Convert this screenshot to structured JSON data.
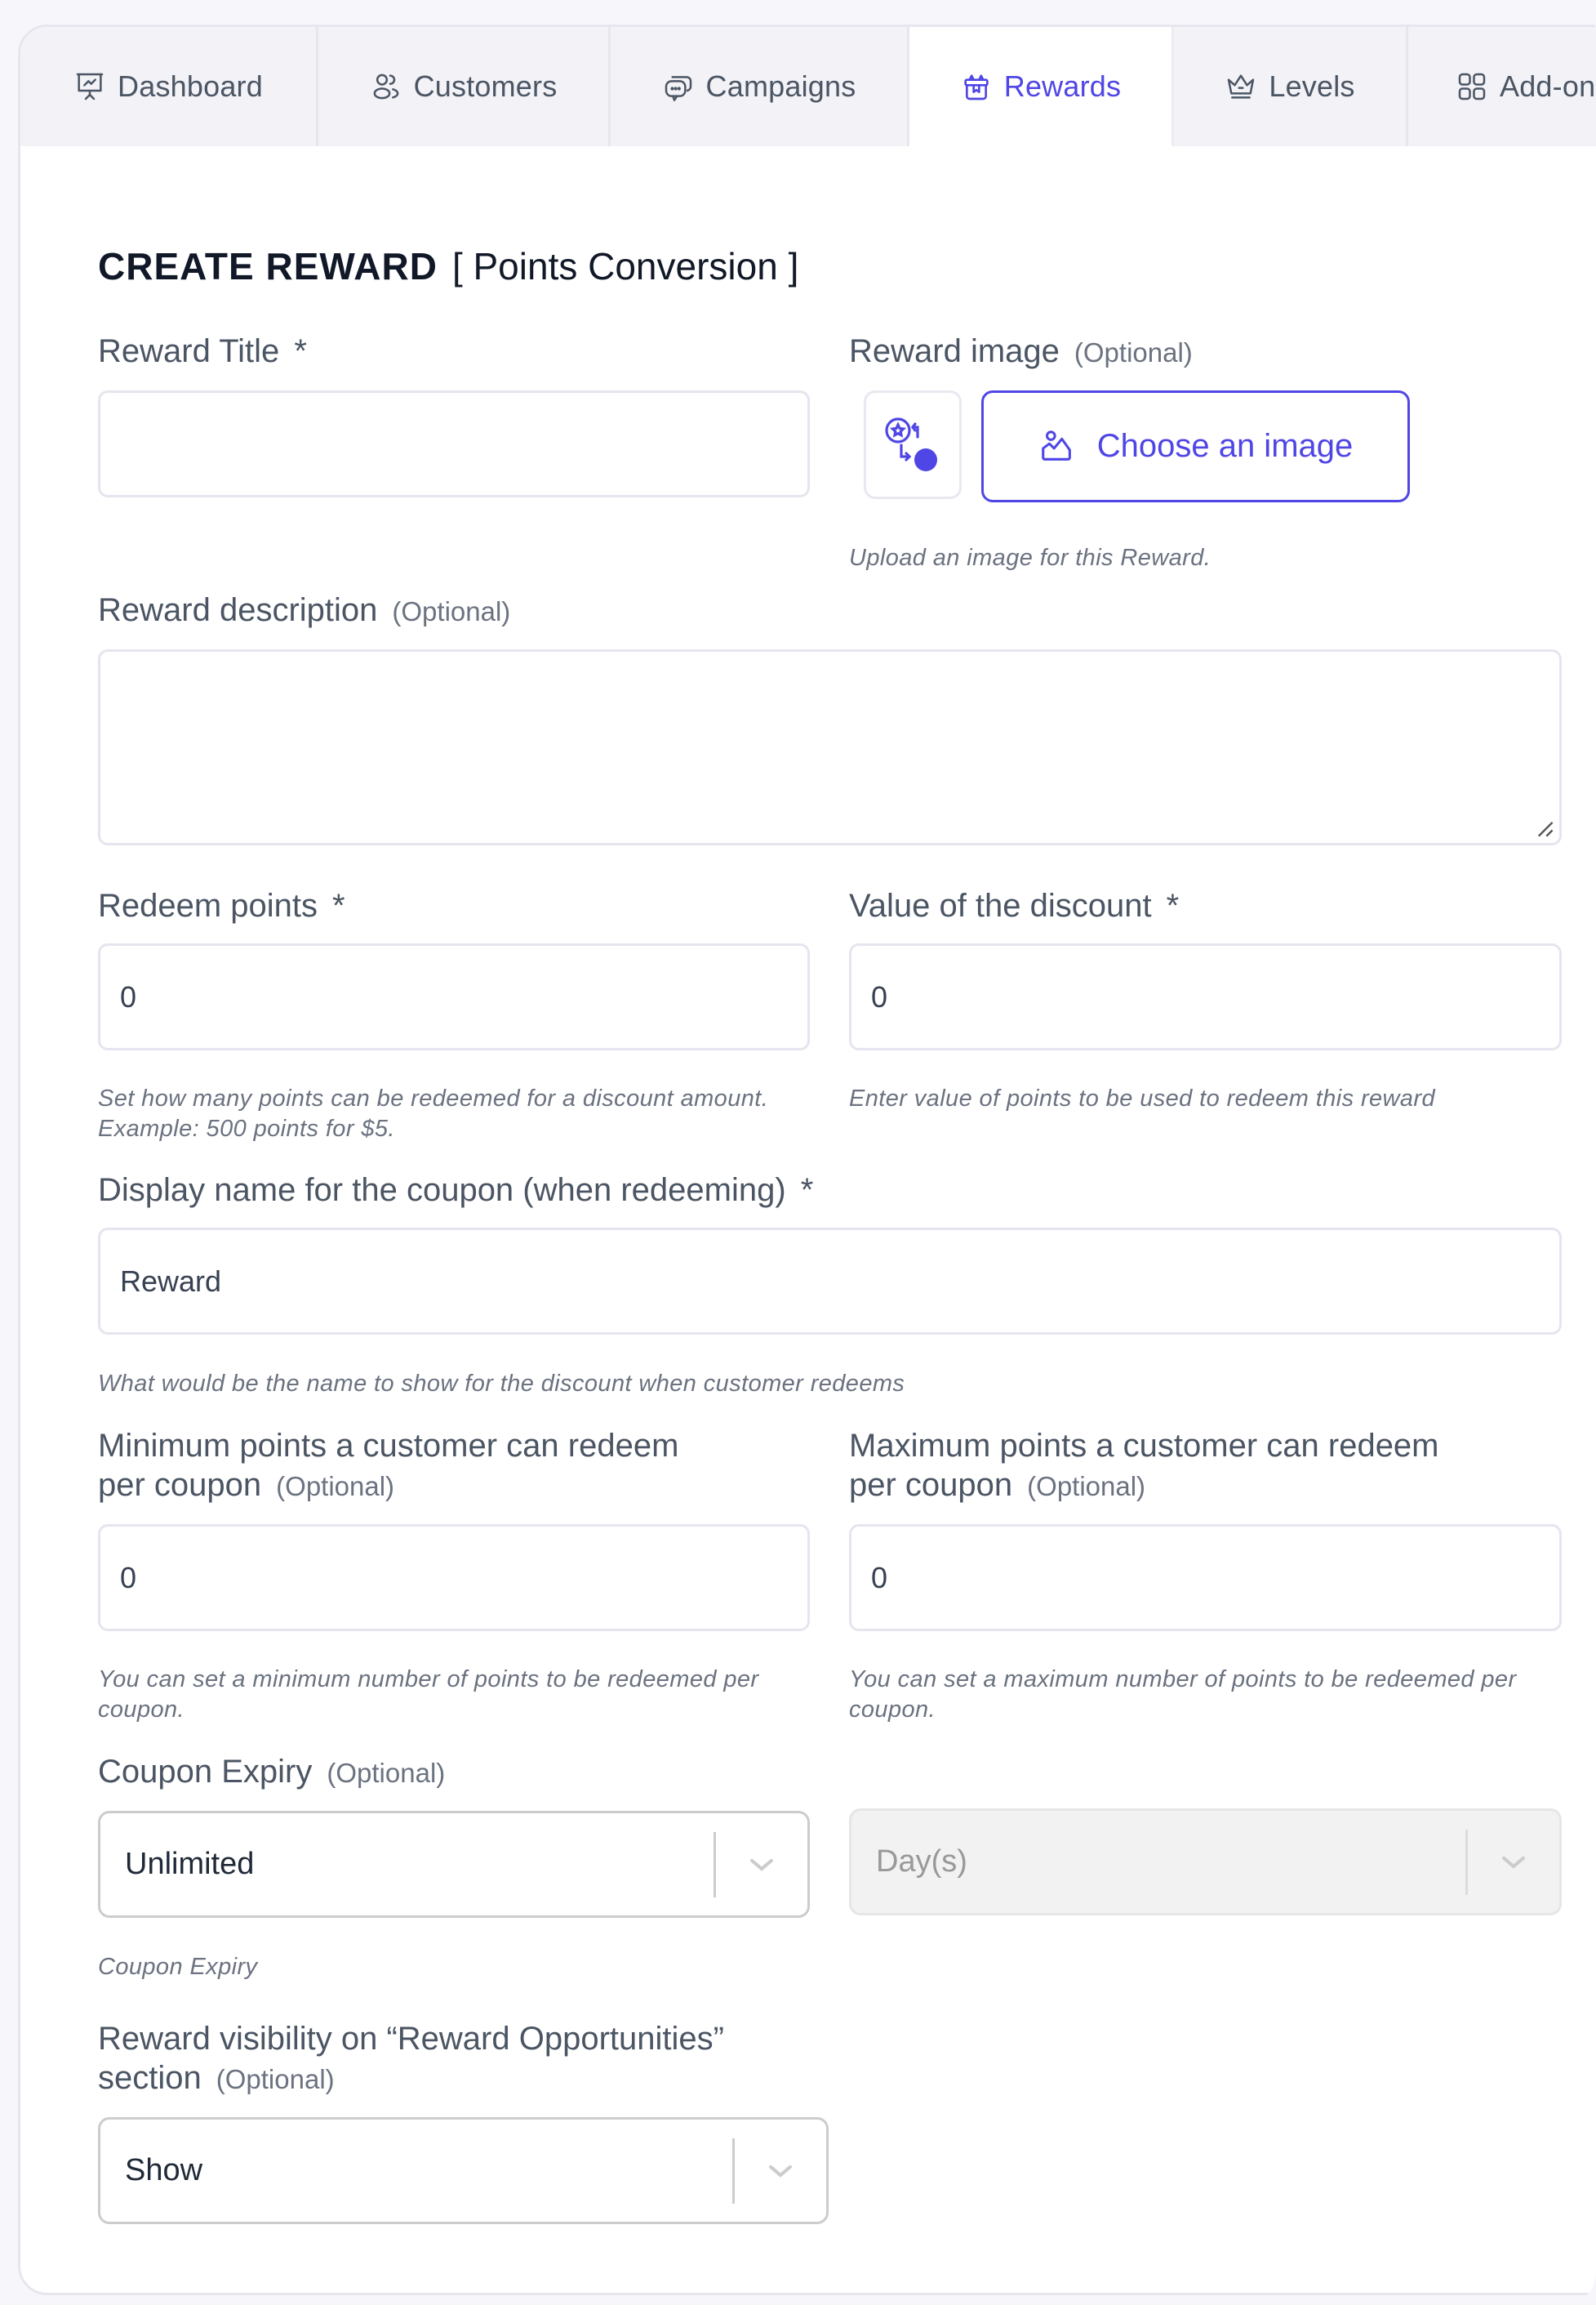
{
  "tabs": [
    {
      "label": "Dashboard",
      "icon": "presentation-chart-icon",
      "active": false
    },
    {
      "label": "Customers",
      "icon": "users-icon",
      "active": false
    },
    {
      "label": "Campaigns",
      "icon": "chat-bubbles-icon",
      "active": false
    },
    {
      "label": "Rewards",
      "icon": "gift-icon",
      "active": true
    },
    {
      "label": "Levels",
      "icon": "crown-icon",
      "active": false
    },
    {
      "label": "Add-ons",
      "icon": "grid-icon",
      "active": false
    }
  ],
  "page": {
    "title": "CREATE REWARD",
    "subtitle": "[ Points Conversion ]"
  },
  "colors": {
    "accent": "#4f46e5",
    "heading": "#111827",
    "label": "#4b5563",
    "help": "#6b7280",
    "tab_bg": "#f2f2f7",
    "page_bg": "#f7f7fb"
  },
  "form": {
    "reward_title": {
      "label": "Reward Title",
      "required": "*",
      "value": ""
    },
    "reward_image": {
      "label": "Reward image",
      "optional": "(Optional)",
      "thumbnail_icon": "points-conversion-icon",
      "button_label": "Choose an image",
      "button_icon": "image-icon",
      "help": "Upload an image for this Reward."
    },
    "reward_description": {
      "label": "Reward description",
      "optional": "(Optional)",
      "value": ""
    },
    "redeem_points": {
      "label": "Redeem points",
      "required": "*",
      "value": "0",
      "help_line1": "Set how many points can be redeemed for a discount amount.",
      "help_line2": "Example: 500 points for $5."
    },
    "discount_value": {
      "label": "Value of the discount",
      "required": "*",
      "value": "0",
      "help": "Enter value of points to be used to redeem this reward"
    },
    "coupon_display_name": {
      "label": "Display name for the coupon (when redeeming)",
      "required": "*",
      "value": "Reward",
      "help": "What would be the name to show for the discount when customer redeems"
    },
    "min_points": {
      "label_line1": "Minimum points a customer can redeem",
      "label_line2": "per coupon",
      "optional": "(Optional)",
      "value": "0",
      "help_line1": "You can set a minimum number of points to be redeemed per",
      "help_line2": "coupon."
    },
    "max_points": {
      "label_line1": "Maximum points a customer can redeem",
      "label_line2": "per coupon",
      "optional": "(Optional)",
      "value": "0",
      "help_line1": "You can set a maximum number of points to be redeemed per",
      "help_line2": "coupon."
    },
    "coupon_expiry": {
      "label": "Coupon Expiry",
      "optional": "(Optional)",
      "selected": "Unlimited",
      "unit_selected": "Day(s)",
      "unit_disabled": true,
      "help": "Coupon Expiry"
    },
    "visibility": {
      "label_line1": "Reward visibility on “Reward Opportunities”",
      "label_line2": "section",
      "optional": "(Optional)",
      "selected": "Show"
    }
  }
}
